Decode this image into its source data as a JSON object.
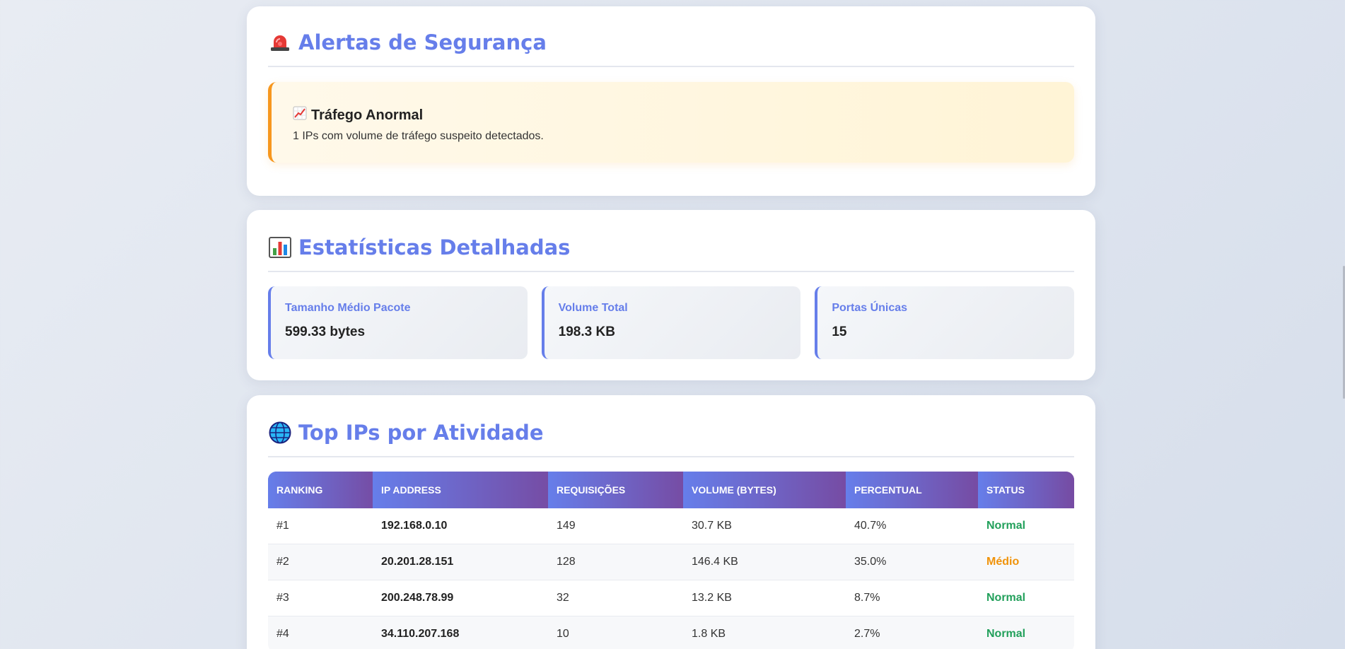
{
  "alerts": {
    "title": "Alertas de Segurança",
    "icon": "siren-icon",
    "items": [
      {
        "icon": "chart-increasing-icon",
        "title": "Tráfego Anormal",
        "description": "1 IPs com volume de tráfego suspeito detectados."
      }
    ]
  },
  "stats": {
    "title": "Estatísticas Detalhadas",
    "icon": "bar-chart-icon",
    "items": [
      {
        "label": "Tamanho Médio Pacote",
        "value": "599.33 bytes"
      },
      {
        "label": "Volume Total",
        "value": "198.3 KB"
      },
      {
        "label": "Portas Únicas",
        "value": "15"
      }
    ]
  },
  "top_ips": {
    "title": "Top IPs por Atividade",
    "icon": "globe-icon",
    "columns": [
      "RANKING",
      "IP ADDRESS",
      "REQUISIÇÕES",
      "VOLUME (BYTES)",
      "PERCENTUAL",
      "STATUS"
    ],
    "rows": [
      {
        "rank": "#1",
        "ip": "192.168.0.10",
        "requests": "149",
        "volume": "30.7 KB",
        "percent": "40.7%",
        "status": "Normal"
      },
      {
        "rank": "#2",
        "ip": "20.201.28.151",
        "requests": "128",
        "volume": "146.4 KB",
        "percent": "35.0%",
        "status": "Médio"
      },
      {
        "rank": "#3",
        "ip": "200.248.78.99",
        "requests": "32",
        "volume": "13.2 KB",
        "percent": "8.7%",
        "status": "Normal"
      },
      {
        "rank": "#4",
        "ip": "34.110.207.168",
        "requests": "10",
        "volume": "1.8 KB",
        "percent": "2.7%",
        "status": "Normal"
      }
    ]
  },
  "colors": {
    "accent": "#667eea",
    "status_normal": "#22a05b",
    "status_medio": "#f0930a",
    "alert_border": "#f7971e"
  }
}
